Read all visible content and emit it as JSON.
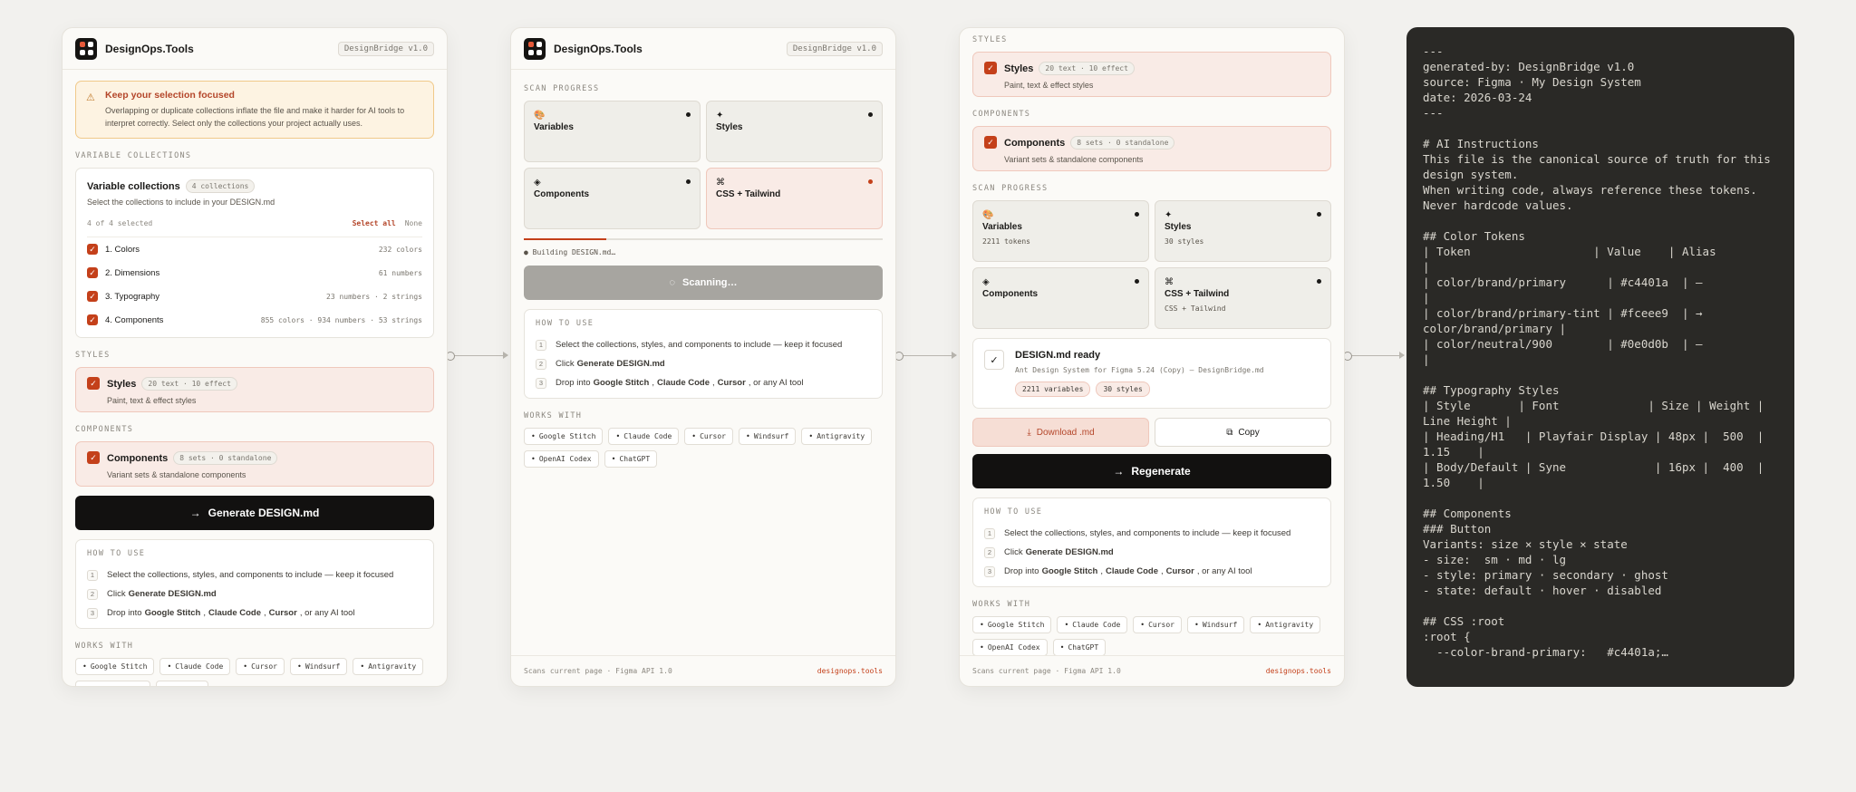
{
  "app": {
    "name": "DesignOps.Tools",
    "version": "DesignBridge v1.0"
  },
  "panel1": {
    "warning": {
      "title": "Keep your selection focused",
      "text": "Overlapping or duplicate collections inflate the file and make it harder for AI tools to interpret correctly. Select only the collections your project actually uses."
    },
    "section_variable": "VARIABLE COLLECTIONS",
    "vc_title": "Variable collections",
    "vc_pill": "4 collections",
    "vc_desc": "Select the collections to include in your DESIGN.md",
    "vc_selected": "4 of 4 selected",
    "select_all": "Select all",
    "none": "None",
    "collections": [
      {
        "label": "1. Colors",
        "meta": "232 colors"
      },
      {
        "label": "2. Dimensions",
        "meta": "61 numbers"
      },
      {
        "label": "3. Typography",
        "meta": "23 numbers · 2 strings"
      },
      {
        "label": "4. Components",
        "meta": "855 colors · 934 numbers · 53 strings"
      }
    ],
    "section_styles": "STYLES",
    "styles": {
      "title": "Styles",
      "pill": "20 text · 10 effect",
      "desc": "Paint, text & effect styles"
    },
    "section_components": "COMPONENTS",
    "components": {
      "title": "Components",
      "pill": "8 sets · 0 standalone",
      "desc": "Variant sets & standalone components"
    },
    "generate": "Generate DESIGN.md"
  },
  "how": {
    "title": "HOW TO USE",
    "s1": "Select the collections, styles, and components to include — keep it focused",
    "s2_pre": "Click",
    "s2_b": "Generate DESIGN.md",
    "s3_pre": "Drop into",
    "s3_b1": "Google Stitch",
    "s3_comma1": ",",
    "s3_b2": "Claude Code",
    "s3_comma2": ",",
    "s3_b3": "Cursor",
    "s3_post": ", or any AI tool"
  },
  "works": {
    "title": "WORKS WITH",
    "tools": [
      "Google Stitch",
      "Claude Code",
      "Cursor",
      "Windsurf",
      "Antigravity",
      "OpenAI Codex",
      "ChatGPT"
    ]
  },
  "footer": {
    "left": "Scans current page · Figma API 1.0",
    "right": "designops.tools"
  },
  "panel2": {
    "section": "SCAN PROGRESS",
    "cards": [
      {
        "icon": "🎨",
        "title": "Variables",
        "sub": ""
      },
      {
        "icon": "✦",
        "title": "Styles",
        "sub": ""
      },
      {
        "icon": "◈",
        "title": "Components",
        "sub": ""
      },
      {
        "icon": "⌘",
        "title": "CSS + Tailwind",
        "sub": ""
      }
    ],
    "progress": 0.23,
    "building": "Building DESIGN.md…",
    "scanning": "Scanning…"
  },
  "panel3": {
    "section_styles": "STYLES",
    "section_components": "COMPONENTS",
    "section_scan": "SCAN PROGRESS",
    "cards": [
      {
        "icon": "🎨",
        "title": "Variables",
        "sub": "2211 tokens"
      },
      {
        "icon": "✦",
        "title": "Styles",
        "sub": "30 styles"
      },
      {
        "icon": "◈",
        "title": "Components",
        "sub": ""
      },
      {
        "icon": "⌘",
        "title": "CSS + Tailwind",
        "sub": "CSS + Tailwind"
      }
    ],
    "ready_title": "DESIGN.md ready",
    "ready_sub": "Ant Design System for Figma 5.24 (Copy) — DesignBridge.md",
    "ready_pills": [
      "2211 variables",
      "30 styles"
    ],
    "download": "Download .md",
    "copy": "Copy",
    "regenerate": "Regenerate"
  },
  "markdown": {
    "text": "---\ngenerated-by: DesignBridge v1.0\nsource: Figma · My Design System\ndate: 2026-03-24\n---\n\n# AI Instructions\nThis file is the canonical source of truth for this design system.\nWhen writing code, always reference these tokens.\nNever hardcode values.\n\n## Color Tokens\n| Token                  | Value    | Alias\n|\n| color/brand/primary      | #c4401a  | —\n|\n| color/brand/primary-tint | #fceee9  | → color/brand/primary |\n| color/neutral/900        | #0e0d0b  | —\n|\n\n## Typography Styles\n| Style       | Font             | Size | Weight | Line Height |\n| Heading/H1   | Playfair Display | 48px |  500  | 1.15    |\n| Body/Default | Syne             | 16px |  400  | 1.50    |\n\n## Components\n### Button\nVariants: size × style × state\n- size:  sm · md · lg\n- style: primary · secondary · ghost\n- state: default · hover · disabled\n\n## CSS :root\n:root {\n  --color-brand-primary:   #c4401a;…"
  },
  "colors": {
    "accent": "#c4401a",
    "dark": "#121110",
    "code_bg": "#2a2926"
  }
}
